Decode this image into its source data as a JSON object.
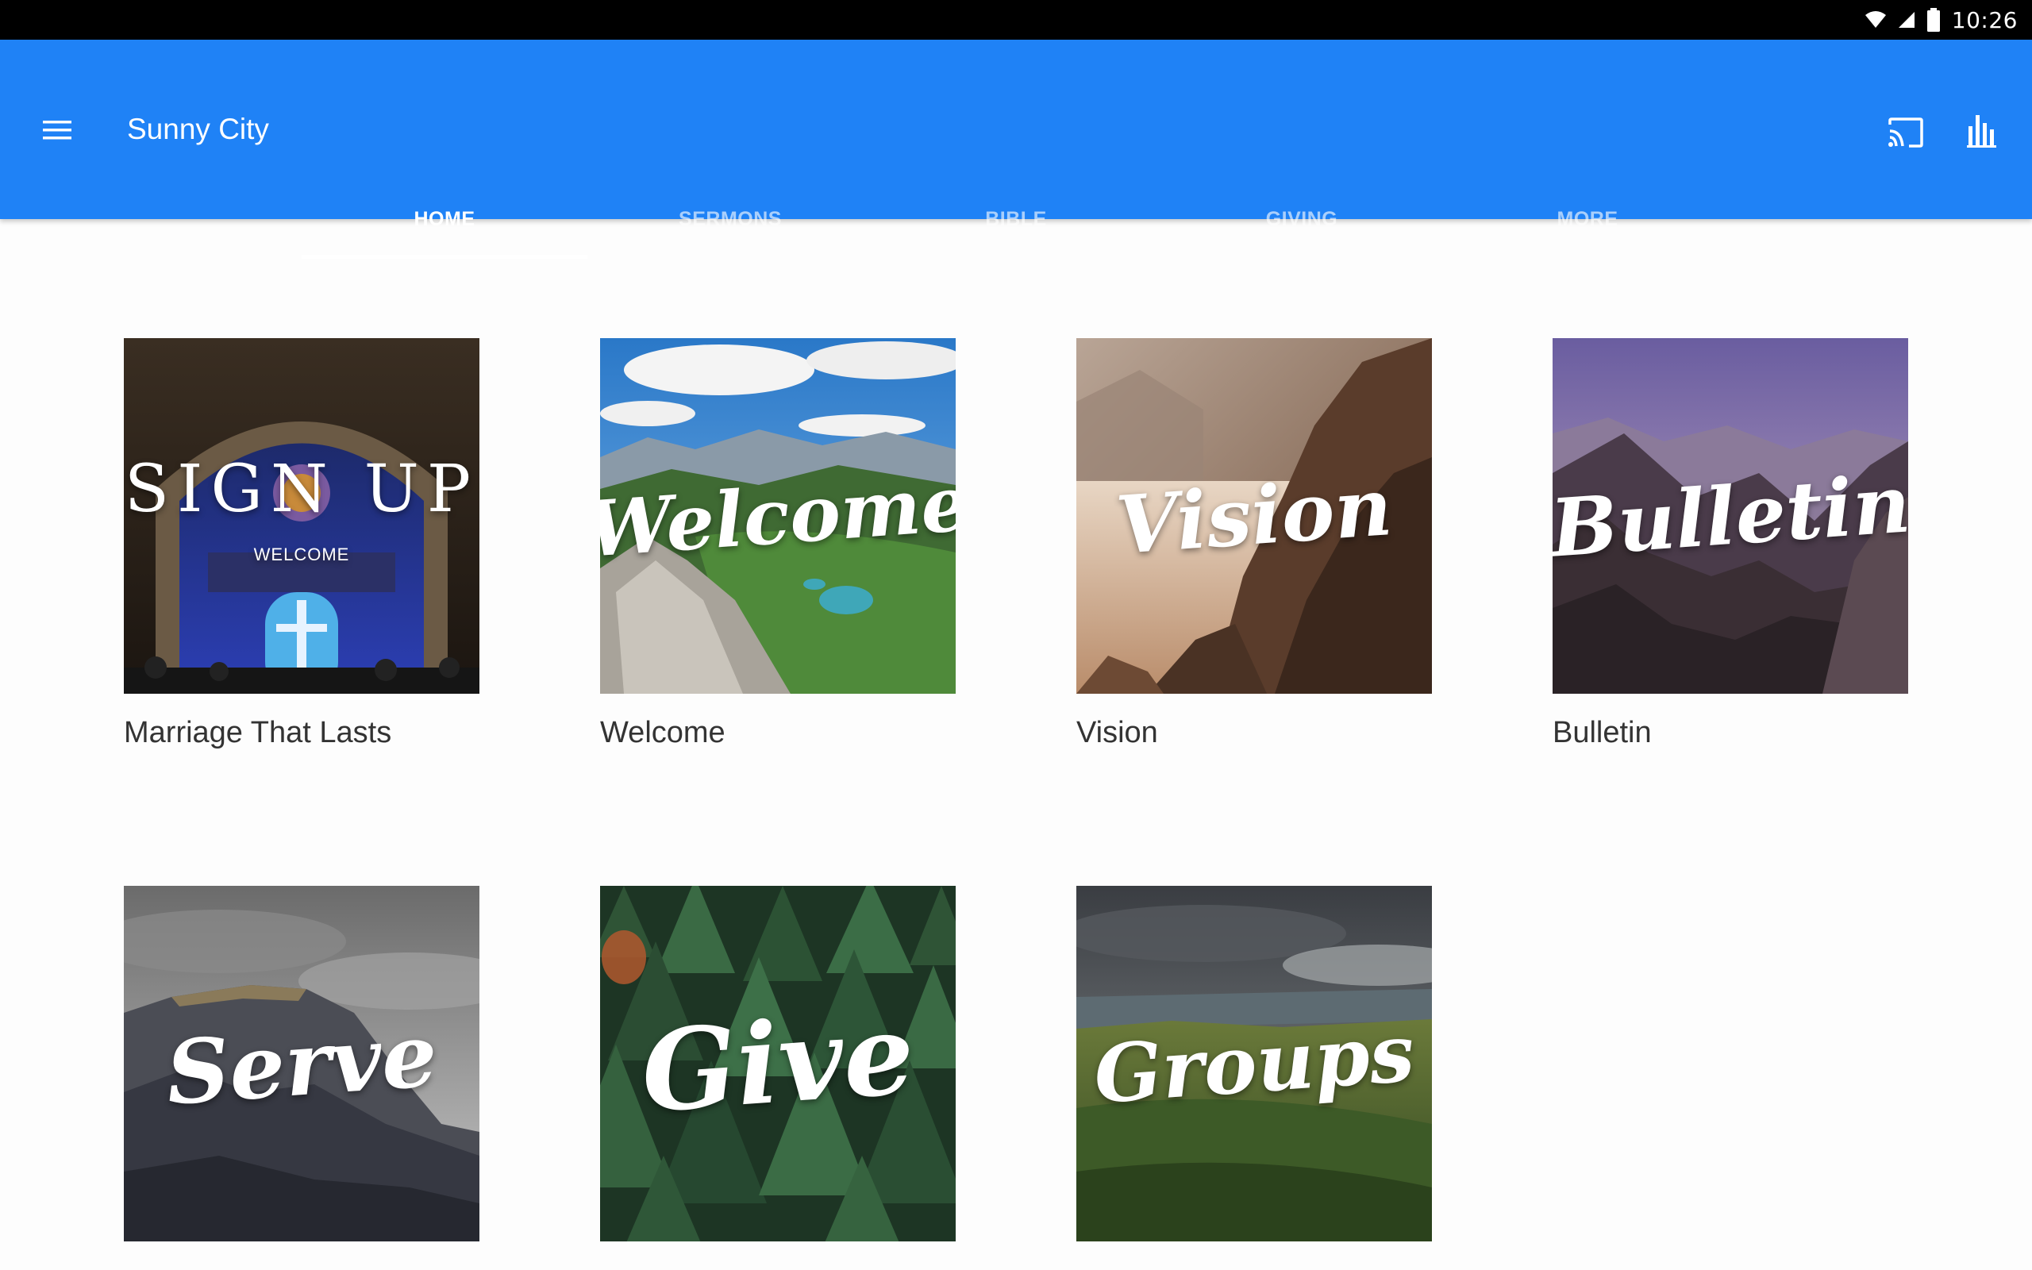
{
  "status_bar": {
    "time": "10:26",
    "icons": [
      "wifi-icon",
      "signal-icon",
      "battery-icon"
    ]
  },
  "app_bar": {
    "title": "Sunny City",
    "menu_icon": "menu-icon",
    "actions": [
      "cast-icon",
      "bar-chart-icon"
    ],
    "color": "#1f82f6"
  },
  "tabs": [
    {
      "label": "HOME",
      "active": true
    },
    {
      "label": "SERMONS",
      "active": false
    },
    {
      "label": "BIBLE",
      "active": false
    },
    {
      "label": "GIVING",
      "active": false
    },
    {
      "label": "MORE",
      "active": false
    }
  ],
  "cards": [
    {
      "caption": "Marriage That Lasts",
      "image_text": "SIGN UP",
      "image_subtext": "WELCOME"
    },
    {
      "caption": "Welcome",
      "image_text": "Welcome"
    },
    {
      "caption": "Vision",
      "image_text": "Vision"
    },
    {
      "caption": "Bulletin",
      "image_text": "Bulletin"
    },
    {
      "caption": "",
      "image_text": "Serve"
    },
    {
      "caption": "",
      "image_text": "Give"
    },
    {
      "caption": "",
      "image_text": "Groups"
    }
  ]
}
